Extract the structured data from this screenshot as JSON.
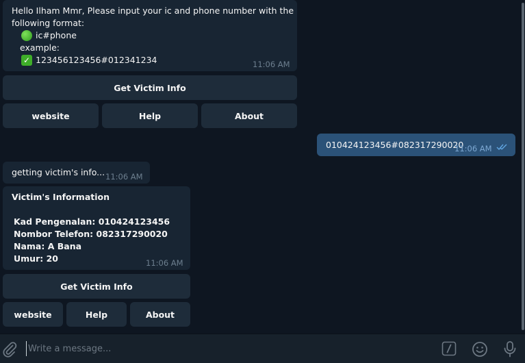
{
  "messages": {
    "greeting": {
      "line1": "Hello Ilham Mmr, Please input your ic and phone number with the",
      "line2": "following format:",
      "format_text": "ic#phone",
      "example_label": "example:",
      "example_text": "123456123456#012341234",
      "time": "11:06 AM"
    },
    "user_input": {
      "text": "010424123456#082317290020",
      "time": "11:06 AM"
    },
    "status": {
      "text": "getting victim's info...",
      "time": "11:06 AM"
    },
    "victim_info": {
      "title": "Victim's Information",
      "kad": "Kad Pengenalan: 010424123456",
      "phone": "Nombor Telefon: 082317290020",
      "name": "Nama: A Bana",
      "age": "Umur: 20",
      "time": "11:06 AM"
    }
  },
  "keyboard1": {
    "get_info": "Get Victim Info",
    "website": "website",
    "help": "Help",
    "about": "About"
  },
  "keyboard2": {
    "get_info": "Get Victim Info",
    "website": "website",
    "help": "Help",
    "about": "About"
  },
  "composer": {
    "placeholder": "Write a message..."
  },
  "icons": {
    "attach": "paperclip-icon",
    "commands": "slash-command-icon",
    "emoji": "smiley-icon",
    "mic": "microphone-icon"
  },
  "colors": {
    "background": "#0e1621",
    "incoming_bubble": "#182533",
    "outgoing_bubble": "#2b5278",
    "keyboard_button": "#1e2c3a",
    "read_check": "#5fa3de"
  }
}
